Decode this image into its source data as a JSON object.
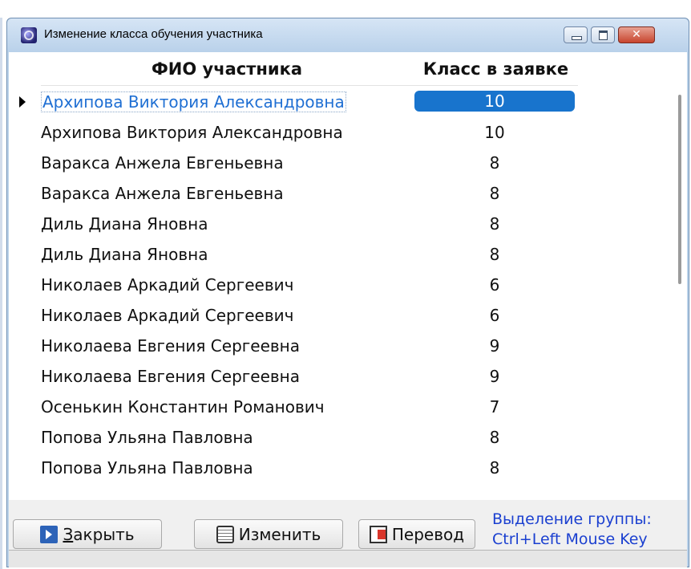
{
  "window": {
    "title": "Изменение класса обучения участника",
    "close_glyph": "✕"
  },
  "grid": {
    "columns": [
      "ФИО участника",
      "Класс в заявке"
    ],
    "selected_index": 0,
    "rows": [
      {
        "name": "Архипова Виктория Александровна",
        "class": "10"
      },
      {
        "name": "Архипова Виктория Александровна",
        "class": "10"
      },
      {
        "name": "Варакса Анжела Евгеньевна",
        "class": "8"
      },
      {
        "name": "Варакса Анжела Евгеньевна",
        "class": "8"
      },
      {
        "name": "Диль Диана Яновна",
        "class": "8"
      },
      {
        "name": "Диль Диана Яновна",
        "class": "8"
      },
      {
        "name": "Николаев Аркадий Сергеевич",
        "class": "6"
      },
      {
        "name": "Николаев Аркадий Сергеевич",
        "class": "6"
      },
      {
        "name": "Николаева Евгения Сергеевна",
        "class": "9"
      },
      {
        "name": "Николаева Евгения Сергеевна",
        "class": "9"
      },
      {
        "name": "Осенькин Константин Романович",
        "class": "7"
      },
      {
        "name": "Попова Ульяна Павловна",
        "class": "8"
      },
      {
        "name": "Попова Ульяна Павловна",
        "class": "8"
      }
    ]
  },
  "buttons": {
    "close_mnemonic": "З",
    "close_rest": "акрыть",
    "edit_label": "Изменить",
    "move_label": "Перевод"
  },
  "hint": {
    "line1": "Выделение группы:",
    "line2": "Ctrl+Left Mouse Key"
  },
  "icons": {
    "app": "app-icon",
    "close": "exit-door-icon",
    "edit": "edit-icon",
    "move": "transfer-icon"
  },
  "colors": {
    "selection": "#1874cd",
    "hint_text": "#1a3fd0"
  }
}
